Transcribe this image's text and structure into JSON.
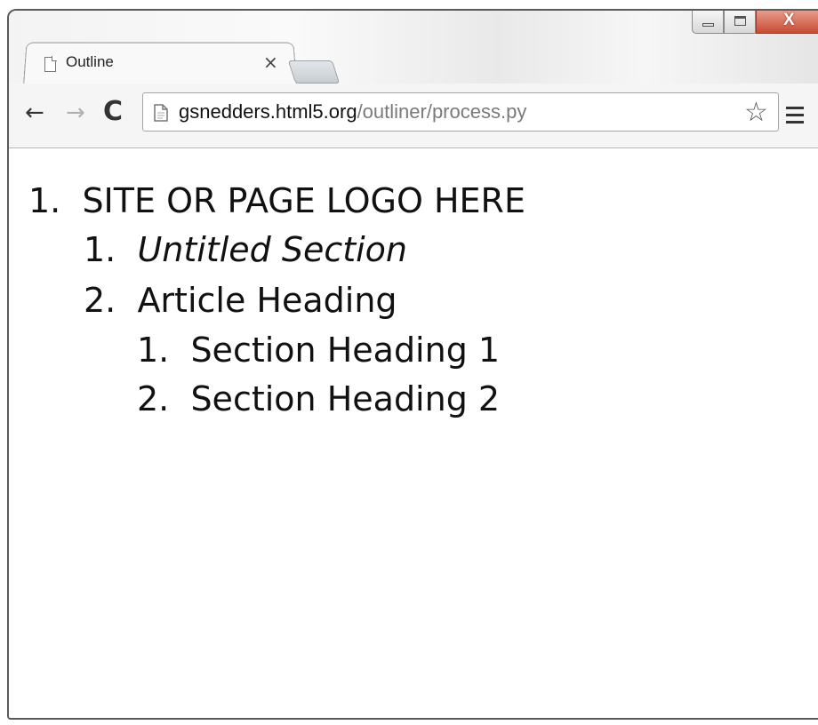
{
  "browser": {
    "tab": {
      "title": "Outline",
      "close_label": "×"
    },
    "window_controls": {
      "close_label": "X"
    },
    "toolbar": {
      "back_glyph": "←",
      "forward_glyph": "→",
      "reload_glyph": "C",
      "star_glyph": "☆"
    },
    "address_bar": {
      "host": "gsnedders.html5.org",
      "path": "/outliner/process.py"
    }
  },
  "outline": {
    "items": [
      {
        "number": "1.",
        "text": "SITE OR PAGE LOGO HERE"
      },
      {
        "number": "1.",
        "text": "Untitled Section"
      },
      {
        "number": "2.",
        "text": "Article Heading"
      },
      {
        "number": "1.",
        "text": "Section Heading 1"
      },
      {
        "number": "2.",
        "text": "Section Heading 2"
      }
    ]
  }
}
